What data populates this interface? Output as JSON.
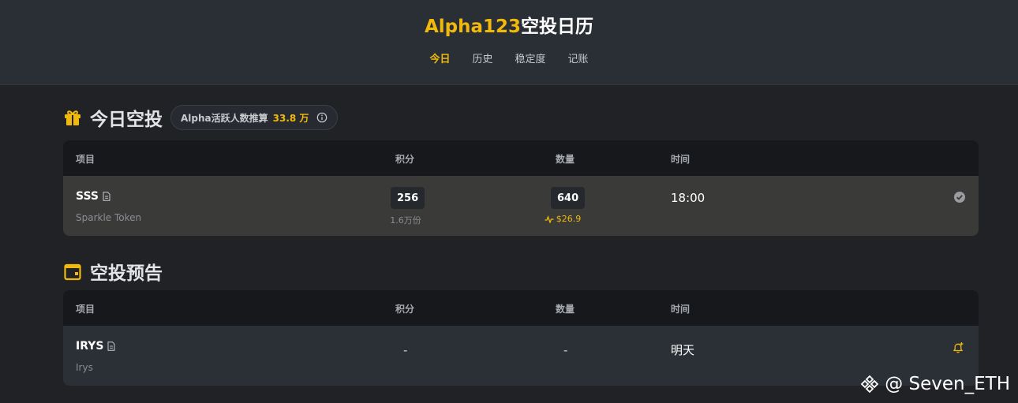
{
  "header": {
    "title_accent": "Alpha123",
    "title_rest": "空投日历",
    "tabs": [
      "今日",
      "历史",
      "稳定度",
      "记账"
    ],
    "active_tab_index": 0
  },
  "today": {
    "section_title": "今日空投",
    "active_users_label": "Alpha活跃人数推算",
    "active_users_value": "33.8 万",
    "columns": [
      "项目",
      "积分",
      "数量",
      "时间"
    ],
    "row": {
      "symbol": "SSS",
      "name": "Sparkle Token",
      "points": "256",
      "points_sub": "1.6万份",
      "quantity": "640",
      "quantity_value": "$26.9",
      "time": "18:00"
    }
  },
  "upcoming": {
    "section_title": "空投预告",
    "columns": [
      "项目",
      "积分",
      "数量",
      "时间"
    ],
    "row": {
      "symbol": "IRYS",
      "name": "Irys",
      "points": "-",
      "quantity": "-",
      "time": "明天"
    }
  },
  "watermark": {
    "text": "@ Seven_ETH"
  },
  "colors": {
    "accent": "#f0b90b",
    "header_bg": "#2a2e35",
    "page_bg": "#202226",
    "table_head_bg": "#16181c",
    "today_row_bg": "#3a3b39",
    "upcoming_row_bg": "#2b2f36"
  },
  "icons": {
    "today_section": "gift-icon",
    "upcoming_section": "calendar-icon",
    "info": "info-icon",
    "doc": "document-icon",
    "done": "check-circle-icon",
    "remind": "bell-plus-icon",
    "trend": "activity-icon",
    "watermark": "binance-logo-icon"
  }
}
